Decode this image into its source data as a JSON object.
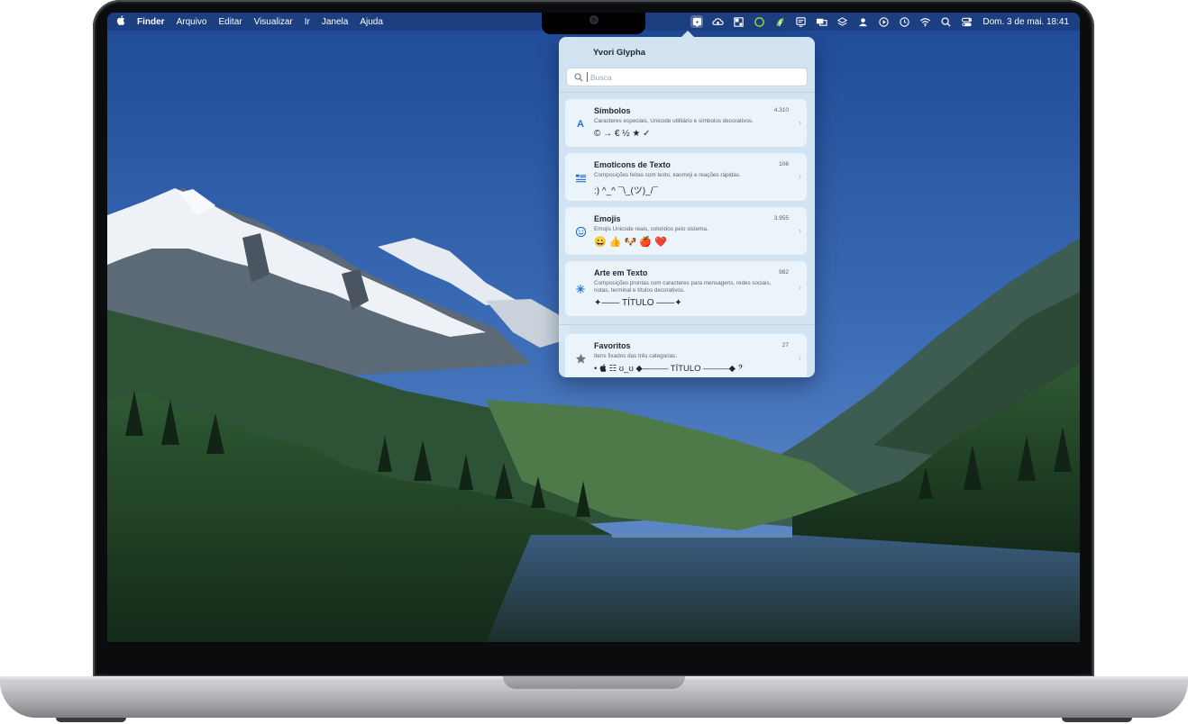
{
  "menubar": {
    "apple": "",
    "items": [
      "Finder",
      "Arquivo",
      "Editar",
      "Visualizar",
      "Ir",
      "Janela",
      "Ajuda"
    ],
    "status_icons": [
      "glypha-icon",
      "cloud-sync-icon",
      "window-grid-icon",
      "circle-ring-icon",
      "lightning-leaf-icon",
      "display-icon",
      "screens-icon",
      "stack-icon",
      "user-icon",
      "play-icon",
      "history-icon",
      "wifi-icon",
      "search-icon",
      "control-center-icon"
    ],
    "clock": "Dom. 3 de mai.  18:41"
  },
  "popover": {
    "app_name": "Yvori Glypha",
    "search_placeholder": "Busca",
    "categories": [
      {
        "title": "Símbolos",
        "count": "4.310",
        "description": "Caracteres especiais, Unicode utilitário e símbolos decorativos.",
        "sample": "© → € ½ ★ ✓",
        "icon": "letter-a-icon"
      },
      {
        "title": "Emoticons de Texto",
        "count": "106",
        "description": "Composições feitas com texto, kaomoji e reações rápidas.",
        "sample": ":) ^_^ ¯\\_(ツ)_/¯",
        "icon": "text-lines-icon"
      },
      {
        "title": "Emojis",
        "count": "3.955",
        "description": "Emojis Unicode reais, coloridos pelo sistema.",
        "sample": "😀 👍 🐶 🍎 ❤️",
        "icon": "smiley-icon"
      },
      {
        "title": "Arte em Texto",
        "count": "982",
        "description": "Composições prontas com caracteres para mensagens, redes sociais, notas, terminal e títulos decorativos.",
        "sample": "✦—— TÍTULO ——✦",
        "icon": "sparkle-icon"
      },
      {
        "title": "Favoritos",
        "count": "27",
        "description": "Itens fixados das três categorias.",
        "sample": "• ",
        "sample_rest": " ☷ ʊ_ʊ ◆——— TÍTULO ———◆ 𝄢",
        "icon": "star-icon"
      }
    ]
  },
  "colors": {
    "accent": "#1f6fde",
    "popover_bg": "#d8e8f5",
    "card_bg": "#ecf4fb"
  }
}
